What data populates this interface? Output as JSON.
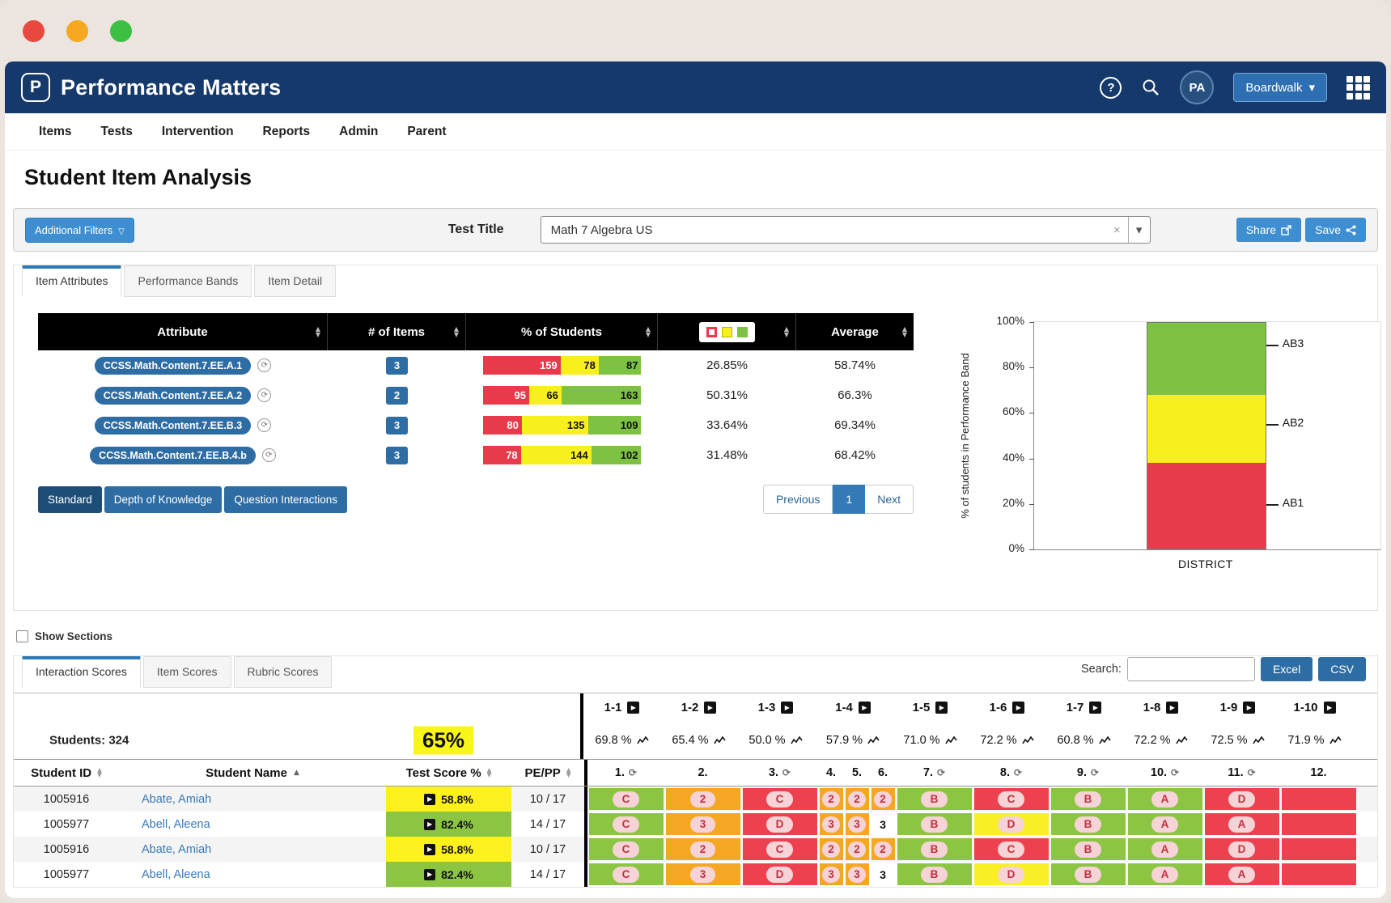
{
  "colors": {
    "navy": "#16396b",
    "accent_blue": "#2e6da4",
    "light_blue_button": "#3d8fd1",
    "band_red": "#e93a4c",
    "band_yellow": "#f7ef1e",
    "band_green": "#7dc242",
    "cell_red": "#ee4150",
    "cell_orange": "#f5a623",
    "cell_green": "#8bc541",
    "cell_yellow": "#f8ef27",
    "score_yellow": "#fcf11d",
    "score_green": "#8bc541",
    "pill_bg": "#f5d3d6",
    "pill_text": "#c2303f",
    "highlight_yellow": "#f8f51a",
    "traffic": [
      "#e8483f",
      "#f6a821",
      "#3dbf44"
    ]
  },
  "icons": {
    "play": "▶",
    "sync": "⟳",
    "help": "?",
    "clear": "×",
    "caret_down": "▾"
  },
  "header": {
    "app_name": "Performance Matters",
    "avatar": "PA",
    "account_button": "Boardwalk"
  },
  "nav": {
    "items": [
      "Items",
      "Tests",
      "Intervention",
      "Reports",
      "Admin",
      "Parent"
    ]
  },
  "page": {
    "title": "Student Item Analysis"
  },
  "filters": {
    "additional_filters_label": "Additional Filters",
    "test_title_label": "Test Title",
    "test_title_value": "Math 7 Algebra US",
    "share_label": "Share",
    "save_label": "Save"
  },
  "attributes_panel": {
    "tabs": [
      {
        "label": "Item Attributes",
        "active": true
      },
      {
        "label": "Performance Bands",
        "active": false
      },
      {
        "label": "Item Detail",
        "active": false
      }
    ],
    "table": {
      "columns": [
        "Attribute",
        "# of Items",
        "% of Students",
        "",
        "Average"
      ],
      "rows": [
        {
          "attribute": "CCSS.Math.Content.7.EE.A.1",
          "items": "3",
          "bands": {
            "red": 159,
            "yellow": 78,
            "green": 87
          },
          "percent": "26.85%",
          "average": "58.74%"
        },
        {
          "attribute": "CCSS.Math.Content.7.EE.A.2",
          "items": "2",
          "bands": {
            "red": 95,
            "yellow": 66,
            "green": 163
          },
          "percent": "50.31%",
          "average": "66.3%"
        },
        {
          "attribute": "CCSS.Math.Content.7.EE.B.3",
          "items": "3",
          "bands": {
            "red": 80,
            "yellow": 135,
            "green": 109
          },
          "percent": "33.64%",
          "average": "69.34%"
        },
        {
          "attribute": "CCSS.Math.Content.7.EE.B.4.b",
          "items": "3",
          "bands": {
            "red": 78,
            "yellow": 144,
            "green": 102
          },
          "percent": "31.48%",
          "average": "68.42%"
        }
      ]
    },
    "footer_buttons": [
      {
        "label": "Standard",
        "active": true
      },
      {
        "label": "Depth of Knowledge",
        "active": false
      },
      {
        "label": "Question Interactions",
        "active": false
      }
    ],
    "pagination": {
      "previous": "Previous",
      "page": "1",
      "next": "Next"
    }
  },
  "chart_data": {
    "type": "bar",
    "stacked": true,
    "categories": [
      "DISTRICT"
    ],
    "series": [
      {
        "name": "AB1",
        "color": "#e93a4c",
        "values": [
          38
        ]
      },
      {
        "name": "AB2",
        "color": "#f7ef1e",
        "values": [
          30
        ]
      },
      {
        "name": "AB3",
        "color": "#7dc242",
        "values": [
          32
        ]
      }
    ],
    "ylabel": "% of students in Performance Band",
    "yticks": [
      "0%",
      "20%",
      "40%",
      "60%",
      "80%",
      "100%"
    ],
    "ylim": [
      0,
      100
    ],
    "legend_position": "none",
    "grid": false,
    "annotations": [
      {
        "label": "AB3",
        "y": 90
      },
      {
        "label": "AB2",
        "y": 55
      },
      {
        "label": "AB1",
        "y": 20
      }
    ]
  },
  "scores_panel": {
    "show_sections_label": "Show Sections",
    "tabs": [
      {
        "label": "Interaction Scores",
        "active": true
      },
      {
        "label": "Item Scores",
        "active": false
      },
      {
        "label": "Rubric Scores",
        "active": false
      }
    ],
    "search_label": "Search:",
    "search_value": "",
    "export_buttons": [
      "Excel",
      "CSV"
    ],
    "students_label": "Students: 324",
    "overall_score": "65%",
    "item_groups": [
      {
        "label": "1-1",
        "percent": "69.8 %"
      },
      {
        "label": "1-2",
        "percent": "65.4 %"
      },
      {
        "label": "1-3",
        "percent": "50.0 %"
      },
      {
        "label": "1-4",
        "percent": "57.9 %"
      },
      {
        "label": "1-5",
        "percent": "71.0 %"
      },
      {
        "label": "1-6",
        "percent": "72.2 %"
      },
      {
        "label": "1-7",
        "percent": "60.8 %"
      },
      {
        "label": "1-8",
        "percent": "72.2 %"
      },
      {
        "label": "1-9",
        "percent": "72.5 %"
      },
      {
        "label": "1-10",
        "percent": "71.9 %"
      }
    ],
    "columns": {
      "student_id": "Student ID",
      "student_name": "Student Name",
      "test_score": "Test Score %",
      "pe_pp": "PE/PP"
    },
    "item_columns": [
      {
        "label": "1.",
        "icon": true,
        "narrow": false
      },
      {
        "label": "2.",
        "icon": false,
        "narrow": false
      },
      {
        "label": "3.",
        "icon": true,
        "narrow": false
      },
      {
        "label": "4.",
        "icon": false,
        "narrow": true
      },
      {
        "label": "5.",
        "icon": false,
        "narrow": true
      },
      {
        "label": "6.",
        "icon": false,
        "narrow": true
      },
      {
        "label": "7.",
        "icon": true,
        "narrow": false
      },
      {
        "label": "8.",
        "icon": true,
        "narrow": false
      },
      {
        "label": "9.",
        "icon": true,
        "narrow": false
      },
      {
        "label": "10.",
        "icon": true,
        "narrow": false
      },
      {
        "label": "11.",
        "icon": true,
        "narrow": false
      },
      {
        "label": "12.",
        "icon": false,
        "narrow": false
      }
    ],
    "rows": [
      {
        "id": "1005916",
        "name": "Abate, Amiah",
        "score": "58.8%",
        "score_color": "yellow",
        "pepp": "10 / 17",
        "cells": [
          {
            "v": "C",
            "bg": "green"
          },
          {
            "v": "2",
            "bg": "orange"
          },
          {
            "v": "C",
            "bg": "red"
          },
          {
            "v": "2",
            "bg": "orange"
          },
          {
            "v": "2",
            "bg": "orange"
          },
          {
            "v": "2",
            "bg": "orange"
          },
          {
            "v": "B",
            "bg": "green"
          },
          {
            "v": "C",
            "bg": "red"
          },
          {
            "v": "B",
            "bg": "green"
          },
          {
            "v": "A",
            "bg": "green"
          },
          {
            "v": "D",
            "bg": "red"
          },
          {
            "v": "",
            "bg": "red"
          }
        ]
      },
      {
        "id": "1005977",
        "name": "Abell, Aleena",
        "score": "82.4%",
        "score_color": "green",
        "pepp": "14 / 17",
        "cells": [
          {
            "v": "C",
            "bg": "green"
          },
          {
            "v": "3",
            "bg": "orange"
          },
          {
            "v": "D",
            "bg": "red"
          },
          {
            "v": "3",
            "bg": "orange"
          },
          {
            "v": "3",
            "bg": "orange"
          },
          {
            "v": "3",
            "bg": "none"
          },
          {
            "v": "B",
            "bg": "green"
          },
          {
            "v": "D",
            "bg": "yellow"
          },
          {
            "v": "B",
            "bg": "green"
          },
          {
            "v": "A",
            "bg": "green"
          },
          {
            "v": "A",
            "bg": "red"
          },
          {
            "v": "",
            "bg": "red"
          }
        ]
      },
      {
        "id": "1005916",
        "name": "Abate, Amiah",
        "score": "58.8%",
        "score_color": "yellow",
        "pepp": "10 / 17",
        "cells": [
          {
            "v": "C",
            "bg": "green"
          },
          {
            "v": "2",
            "bg": "orange"
          },
          {
            "v": "C",
            "bg": "red"
          },
          {
            "v": "2",
            "bg": "orange"
          },
          {
            "v": "2",
            "bg": "orange"
          },
          {
            "v": "2",
            "bg": "orange"
          },
          {
            "v": "B",
            "bg": "green"
          },
          {
            "v": "C",
            "bg": "red"
          },
          {
            "v": "B",
            "bg": "green"
          },
          {
            "v": "A",
            "bg": "green"
          },
          {
            "v": "D",
            "bg": "red"
          },
          {
            "v": "",
            "bg": "red"
          }
        ]
      },
      {
        "id": "1005977",
        "name": "Abell, Aleena",
        "score": "82.4%",
        "score_color": "green",
        "pepp": "14 / 17",
        "cells": [
          {
            "v": "C",
            "bg": "green"
          },
          {
            "v": "3",
            "bg": "orange"
          },
          {
            "v": "D",
            "bg": "red"
          },
          {
            "v": "3",
            "bg": "orange"
          },
          {
            "v": "3",
            "bg": "orange"
          },
          {
            "v": "3",
            "bg": "none"
          },
          {
            "v": "B",
            "bg": "green"
          },
          {
            "v": "D",
            "bg": "yellow"
          },
          {
            "v": "B",
            "bg": "green"
          },
          {
            "v": "A",
            "bg": "green"
          },
          {
            "v": "A",
            "bg": "red"
          },
          {
            "v": "",
            "bg": "red"
          }
        ]
      }
    ]
  }
}
